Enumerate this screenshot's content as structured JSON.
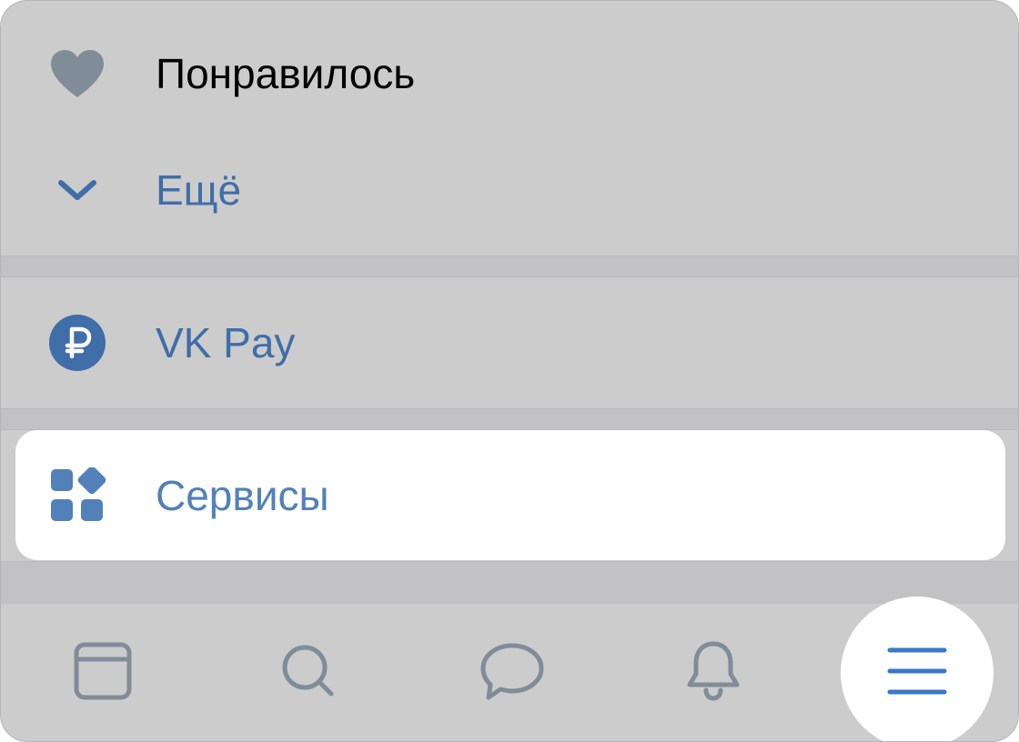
{
  "menu": {
    "items": [
      {
        "label": "Понравилось",
        "icon": "heart-icon"
      },
      {
        "label": "Ещё",
        "icon": "chevron-down-icon"
      }
    ]
  },
  "payments": {
    "label": "VK Pay",
    "icon": "ruble-icon"
  },
  "services": {
    "label": "Сервисы",
    "icon": "services-icon",
    "selected": true
  },
  "tabbar": {
    "tabs": [
      {
        "name": "feed",
        "icon": "feed-icon"
      },
      {
        "name": "search",
        "icon": "search-icon"
      },
      {
        "name": "messages",
        "icon": "messages-icon"
      },
      {
        "name": "notifications",
        "icon": "bell-icon"
      },
      {
        "name": "menu",
        "icon": "menu-icon",
        "active": true
      }
    ]
  },
  "colors": {
    "accent": "#5181b8",
    "link": "#3f6ea8",
    "icon_gray": "#818c99",
    "background": "#cccccc",
    "active_tab_bg": "#ffffff"
  }
}
